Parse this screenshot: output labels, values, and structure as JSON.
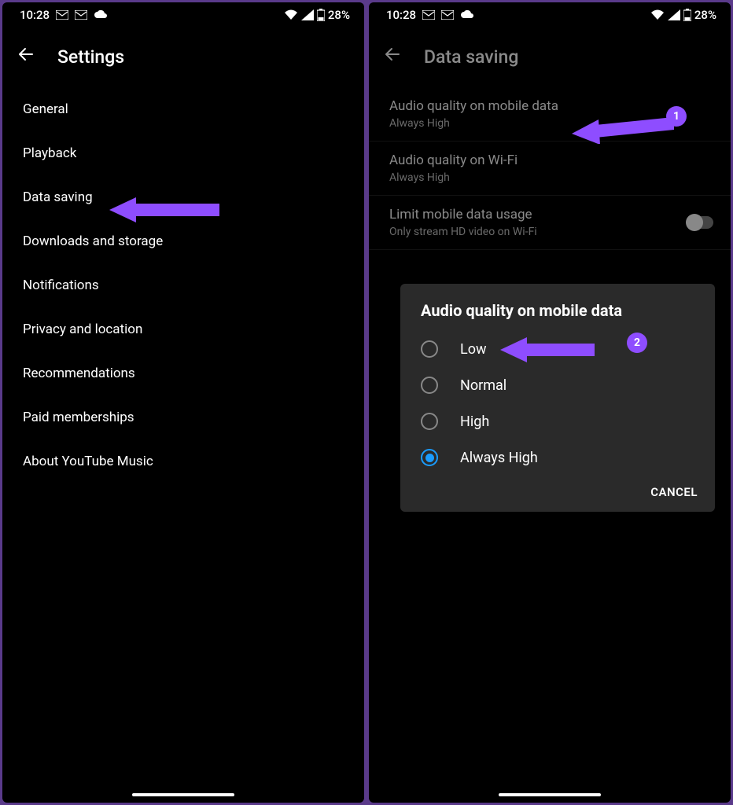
{
  "status": {
    "time": "10:28",
    "battery": "28%"
  },
  "left": {
    "header": {
      "title": "Settings"
    },
    "items": [
      "General",
      "Playback",
      "Data saving",
      "Downloads and storage",
      "Notifications",
      "Privacy and location",
      "Recommendations",
      "Paid memberships",
      "About YouTube Music"
    ]
  },
  "right": {
    "header": {
      "title": "Data saving"
    },
    "items": [
      {
        "title": "Audio quality on mobile data",
        "subtitle": "Always High"
      },
      {
        "title": "Audio quality on Wi-Fi",
        "subtitle": "Always High"
      },
      {
        "title": "Limit mobile data usage",
        "subtitle": "Only stream HD video on Wi-Fi"
      }
    ],
    "dialog": {
      "title": "Audio quality on mobile data",
      "options": [
        "Low",
        "Normal",
        "High",
        "Always High"
      ],
      "selected": "Always High",
      "cancel": "CANCEL"
    }
  },
  "annotations": {
    "badge1": "1",
    "badge2": "2"
  }
}
